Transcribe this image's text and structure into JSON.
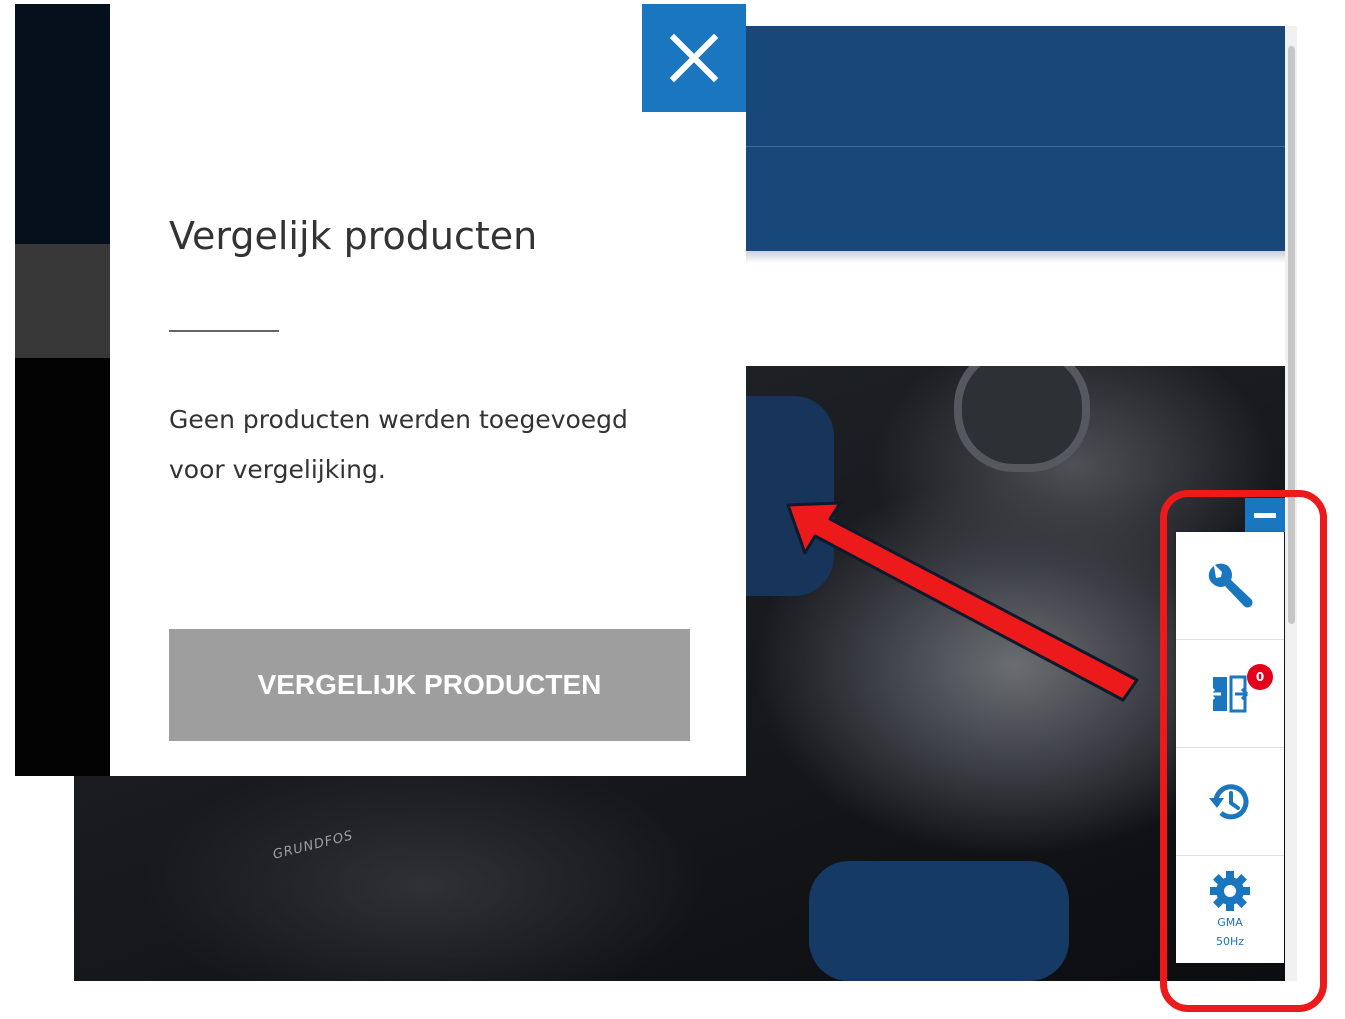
{
  "modal": {
    "title": "Vergelijk producten",
    "message_line1": "Geen producten werden toegevoegd",
    "message_line2": "voor vergelijking.",
    "compare_button_label": "VERGELIJK PRODUCTEN",
    "close_icon": "close-icon"
  },
  "toolbar": {
    "collapse_icon": "minus-icon",
    "items": [
      {
        "icon": "wrench-icon"
      },
      {
        "icon": "compare-icon",
        "badge": "0"
      },
      {
        "icon": "history-icon"
      },
      {
        "icon": "gear-icon",
        "label_line1": "GMA",
        "label_line2": "50Hz"
      }
    ]
  },
  "background": {
    "logo_text": "GRUNDFOS"
  },
  "colors": {
    "accent_blue": "#1a76be",
    "header_blue": "#18487a",
    "button_grey": "#9e9e9e",
    "badge_red": "#e2001a",
    "annotation_red": "#ec1a1a"
  }
}
